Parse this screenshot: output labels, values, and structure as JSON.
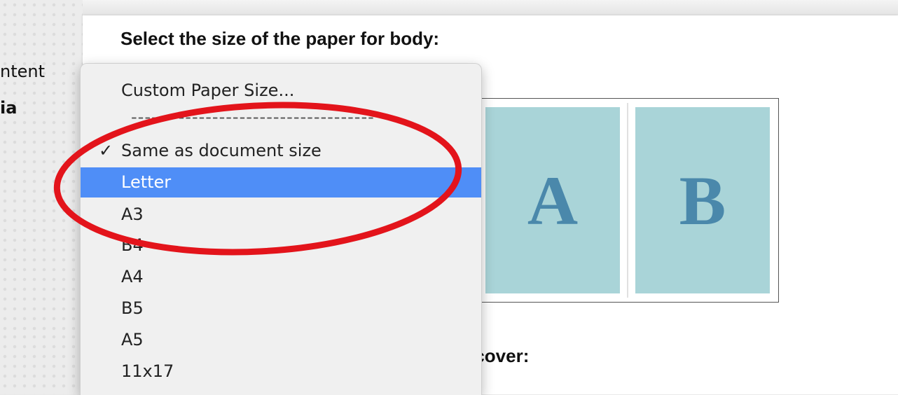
{
  "sidebar": {
    "items": [
      {
        "label": "ntent"
      },
      {
        "label": "ia"
      }
    ]
  },
  "main": {
    "heading_body": "Select the size of the paper for body:",
    "heading_cover_fragment": "r cover:",
    "preview": {
      "pages": [
        {
          "letter": "A"
        },
        {
          "letter": "B"
        }
      ],
      "page_color": "#a9d4d8",
      "letter_color": "#4a88ab"
    }
  },
  "dropdown": {
    "custom_option": "Custom Paper Size...",
    "separator": "------------------------------------",
    "checkmark": "✓",
    "options": [
      {
        "label": "Same as document size",
        "checked": true
      },
      {
        "label": "Letter",
        "highlighted": true
      },
      {
        "label": "A3"
      },
      {
        "label": "B4"
      },
      {
        "label": "A4"
      },
      {
        "label": "B5"
      },
      {
        "label": "A5"
      },
      {
        "label": "11x17"
      }
    ],
    "highlight_color": "#4f8ef7"
  },
  "annotation": {
    "shape": "ellipse",
    "color": "#e3141b"
  }
}
